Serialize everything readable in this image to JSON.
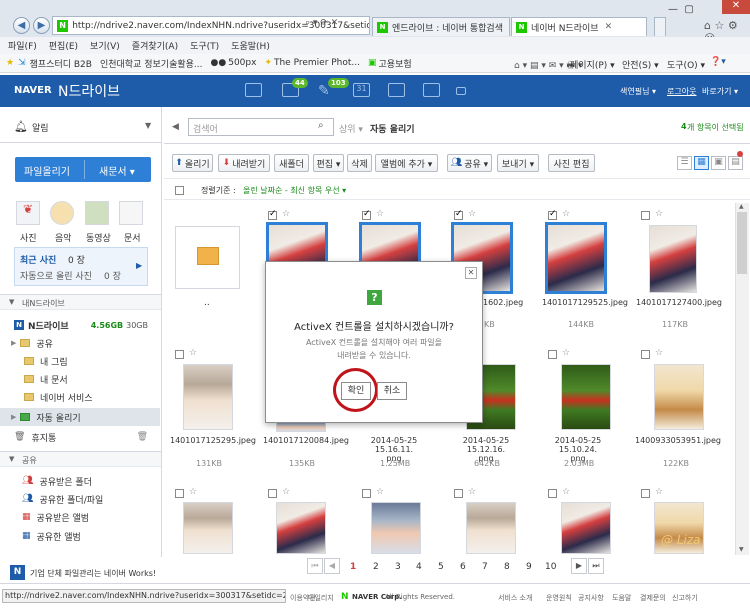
{
  "browser": {
    "address": "http://ndrive2.naver.com/IndexNHN.ndrive?useridx=300317&setidc=2",
    "tabs": [
      {
        "label": "엔드라이브 : 네이버 통합검색"
      },
      {
        "label": "네이버 N드라이브"
      }
    ],
    "menu": [
      "파일(F)",
      "편집(E)",
      "보기(V)",
      "즐겨찾기(A)",
      "도구(T)",
      "도움말(H)"
    ],
    "favorites": [
      "챔프스터디 B2B",
      "인천대학교 정보기술활용...",
      "500px",
      "The Premier Phot...",
      "고용보험"
    ],
    "tools": [
      "페이지(P) ▾",
      "안전(S) ▾",
      "도구(O) ▾"
    ]
  },
  "header": {
    "logo": "NAVER",
    "service": "N드라이브",
    "mail_badge": "44",
    "cafe_badge": "103",
    "user": "색연필님 ▾",
    "logout": "로그아웃",
    "shortcut": "바로가기 ▾"
  },
  "sidebar": {
    "alarm": "알림",
    "upload": "파일올리기",
    "new_doc": "새문서 ▾",
    "media": [
      "사진",
      "음악",
      "동영상",
      "문서"
    ],
    "recent_title": "최근 사진",
    "recent_count": "0 장",
    "recent_auto": "자동으로 올린 사진",
    "recent_auto_count": "0 장",
    "section_mine": "내N드라이브",
    "drive_name": "N드라이브",
    "drive_used": "4.56GB",
    "drive_total": "30GB",
    "folders": [
      "공유",
      "내 그림",
      "내 문서",
      "네이버 서비스",
      "자동 올리기",
      "휴지통"
    ],
    "section_share": "공유",
    "share_items": [
      "공유받은 폴더",
      "공유한 폴더/파일",
      "공유받은 앨범",
      "공유한 앨범"
    ],
    "works_text": "기업 단체 파일관리는 네이버 Works!"
  },
  "main": {
    "search_placeholder": "검색어",
    "search_scope": "상위 ▾",
    "folder_title": "자동 올리기",
    "selected_count": "4",
    "selected_text": "개 항목이 선택됨",
    "toolbar": [
      "올리기",
      "내려받기",
      "새폴더",
      "편집 ▾",
      "삭제",
      "앨범에 추가 ▾",
      "공유 ▾",
      "보내기 ▾",
      "사진 편집"
    ],
    "sort_label": "정렬기준 :",
    "sort_value": "올린 날짜순 - 최신 항목 우선 ▾",
    "up_label": "..",
    "row1": [
      {
        "name": "",
        "size": ""
      },
      {
        "name": "",
        "size": ""
      },
      {
        "name": "",
        "size": ""
      },
      {
        "name": "1602.jpeg",
        "size": "KB"
      },
      {
        "name": "1401017129525.jpeg",
        "size": "144KB"
      },
      {
        "name": "1401017127400.jpeg",
        "size": "117KB"
      }
    ],
    "row2": [
      {
        "name": "1401017125295.jpeg",
        "size": "131KB"
      },
      {
        "name": "1401017120084.jpeg",
        "size": "135KB"
      },
      {
        "name": "2014-05-25 15.16.11.\npng",
        "size": "1.25MB"
      },
      {
        "name": "2014-05-25 15.12.16.\npng",
        "size": "642KB"
      },
      {
        "name": "2014-05-25 15.10.24.\npng",
        "size": "2.03MB"
      },
      {
        "name": "1400933053951.jpeg",
        "size": "122KB"
      }
    ],
    "pages": [
      "1",
      "2",
      "3",
      "4",
      "5",
      "6",
      "7",
      "8",
      "9",
      "10"
    ],
    "current_page": "1",
    "watermark": "@ Liza"
  },
  "dialog": {
    "icon": "?",
    "title": "ActiveX 컨트롤을 설치하시겠습니까?",
    "message": "ActiveX 컨트롤을 설치해야 여러 파일을\n내려받을 수 있습니다.",
    "ok": "확인",
    "cancel": "취소"
  },
  "status": {
    "url": "http://ndrive2.naver.com/IndexNHN.ndrive?useridx=300317&setidc=2&",
    "links": [
      "이용약관",
      "마일리지"
    ],
    "copyright": "NAVER Corp.",
    "rights": "All Rights Reserved.",
    "footer_links": [
      "서비스 소개",
      "운영원칙",
      "공지사항",
      "도움말",
      "결제문의",
      "신고하기"
    ]
  },
  "colors": {
    "naver_blue": "#1e5ba8",
    "naver_green": "#1ec800",
    "highlight_red": "#c0141b"
  }
}
